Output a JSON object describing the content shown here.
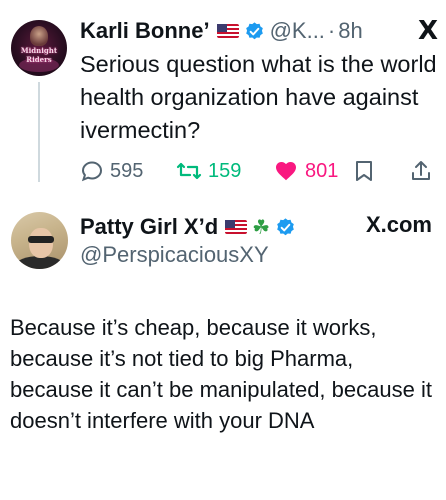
{
  "tweet1": {
    "author_name": "Karli Bonne’",
    "handle": "@K...",
    "dot": "·",
    "time": "8h",
    "avatar_text": "Midnight Riders",
    "x_logo": "X",
    "text": "Serious question what is the world health organization have against ivermectin?",
    "actions": {
      "replies": "595",
      "reposts": "159",
      "likes": "801"
    }
  },
  "tweet2": {
    "author_name": "Patty Girl X’d",
    "handle": "@PerspicaciousXY",
    "clover": "☘",
    "site": "X.com",
    "text": "Because it’s cheap, because it works, because it’s not tied to big Pharma, because it can’t be manipulated, because it doesn’t interfere with your DNA"
  },
  "colors": {
    "text": "#0f1419",
    "muted": "#536471",
    "verified_blue": "#1d9bf0",
    "repost_green": "#00ba7c",
    "like_pink": "#f91880"
  },
  "icons": [
    "us-flag-icon",
    "verified-badge-icon",
    "x-logo-icon",
    "reply-icon",
    "repost-icon",
    "like-icon",
    "bookmark-icon",
    "share-icon",
    "shamrock-icon"
  ]
}
